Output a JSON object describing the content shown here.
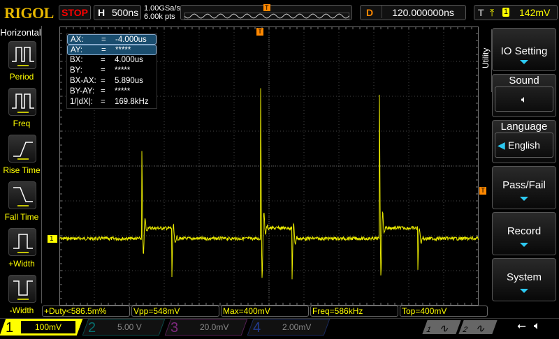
{
  "header": {
    "logo": "RIGOL",
    "run_state": "STOP",
    "h_label": "H",
    "timebase": "500ns",
    "sample_rate": "1.00GSa/s",
    "memory_depth": "6.00k pts",
    "trigger_marker": "T",
    "delay_label": "D",
    "delay": "120.000000ns",
    "trig_label": "T",
    "trig_source": "1",
    "trig_level": "142mV"
  },
  "left_menu": {
    "title": "Horizontal",
    "items": [
      {
        "label": "Period"
      },
      {
        "label": "Freq"
      },
      {
        "label": "Rise Time"
      },
      {
        "label": "Fall Time"
      },
      {
        "label": "+Width"
      },
      {
        "label": "-Width"
      }
    ]
  },
  "cursor": {
    "rows": [
      {
        "k": "AX:",
        "v": "-4.000us"
      },
      {
        "k": "AY:",
        "v": "*****"
      },
      {
        "k": "BX:",
        "v": "4.000us"
      },
      {
        "k": "BY:",
        "v": "*****"
      },
      {
        "k": "BX-AX:",
        "v": "5.890us"
      },
      {
        "k": "BY-AY:",
        "v": "*****"
      },
      {
        "k": "1/|dX|:",
        "v": "169.8kHz"
      }
    ],
    "eq": "="
  },
  "right_menu": {
    "tab": "Utility",
    "io": "IO Setting",
    "sound": "Sound",
    "language": "Language",
    "language_value": "English",
    "passfail": "Pass/Fail",
    "record": "Record",
    "system": "System"
  },
  "markers": {
    "ch1": "1",
    "trig": "T"
  },
  "measurements": [
    "+Duty<586.5m%",
    "Vpp=548mV",
    "Max=400mV",
    "Freq=586kHz",
    "Top=400mV"
  ],
  "channels": [
    {
      "n": "1",
      "scale": "100mV",
      "color": "#ffff00"
    },
    {
      "n": "2",
      "scale": "5.00 V",
      "color": "#00c0c0"
    },
    {
      "n": "3",
      "scale": "20.0mV",
      "color": "#e040e0"
    },
    {
      "n": "4",
      "scale": "2.00mV",
      "color": "#3060ff"
    }
  ],
  "gen": [
    "1",
    "2"
  ]
}
